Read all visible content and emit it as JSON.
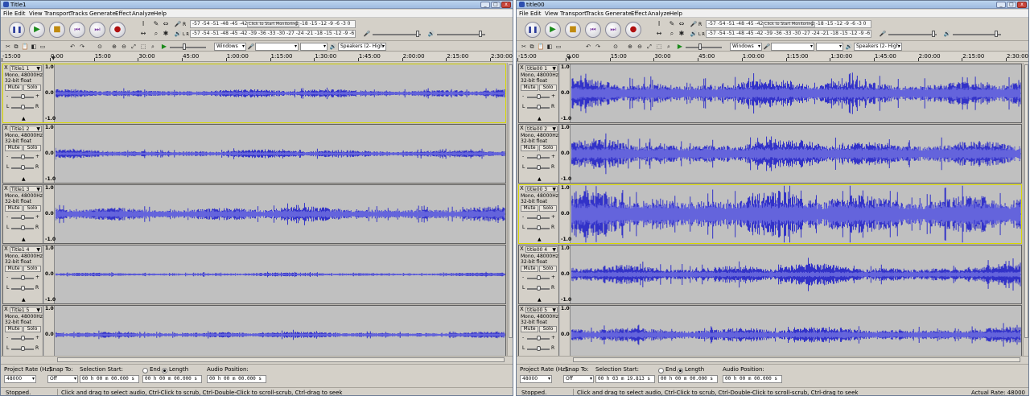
{
  "colors": {
    "wave": "#3232c8",
    "wave_rms": "#6464dc",
    "track_bg": "#c0c0c0",
    "selected_border": "#d8d800"
  },
  "menu": [
    "File",
    "Edit",
    "View",
    "Transport",
    "Tracks",
    "Generate",
    "Effect",
    "Analyze",
    "Help"
  ],
  "transport_icons": [
    "pause-icon",
    "play-icon",
    "stop-icon",
    "skip-start-icon",
    "skip-end-icon",
    "record-icon"
  ],
  "meters": {
    "rec_label": "R",
    "play_label": "L R",
    "rec_scale": "-57 -54 -51 -48 -45 -42 -",
    "monitor_label": "Click to Start Monitoring",
    "rec_scale_tail": "-1 -18 -15 -12 -9 -6 -3 0",
    "play_scale": "-57 -54 -51 -48 -45 -42 -39 -36 -33 -30 -27 -24 -21 -18 -15 -12 -9 -6 -3 0"
  },
  "devices": {
    "host": "Windows",
    "output": "Speakers (2- High"
  },
  "windows": [
    {
      "title": "Title1",
      "ruler": [
        "-15:00",
        "0:00",
        "15:00",
        "30:00",
        "45:00",
        "1:00:00",
        "1:15:00",
        "1:30:00",
        "1:45:00",
        "2:00:00",
        "2:15:00",
        "2:30:00"
      ],
      "tracks": [
        {
          "name": "Title1 1",
          "sel": true,
          "amp": 0.16,
          "rms": 0.06,
          "seed": 11
        },
        {
          "name": "Title1 2",
          "sel": false,
          "amp": 0.16,
          "rms": 0.06,
          "seed": 23
        },
        {
          "name": "Title1 3",
          "sel": false,
          "amp": 0.28,
          "rms": 0.14,
          "seed": 37
        },
        {
          "name": "Title1 4",
          "sel": false,
          "amp": 0.07,
          "rms": 0.03,
          "seed": 41
        },
        {
          "name": "Title1 5",
          "sel": false,
          "amp": 0.12,
          "rms": 0.05,
          "seed": 53
        }
      ],
      "project_rate": "48000",
      "snap": "Off",
      "selection_start": "00 h 00 m 00.000 s",
      "selection_length": "00 h 00 m 00.000 s",
      "audio_position": "00 h 00 m 00.000 s",
      "status_left": "Stopped.",
      "status_right": "",
      "status_hint": "Click and drag to select audio, Ctrl-Click to scrub, Ctrl-Double-Click to scroll-scrub, Ctrl-drag to seek"
    },
    {
      "title": "title00",
      "ruler": [
        "-15:00",
        "0:00",
        "15:00",
        "30:00",
        "45:00",
        "1:00:00",
        "1:15:00",
        "1:30:00",
        "1:45:00",
        "2:00:00",
        "2:15:00",
        "2:30:00"
      ],
      "tracks": [
        {
          "name": "title00 1",
          "sel": false,
          "amp": 0.55,
          "rms": 0.22,
          "seed": 61
        },
        {
          "name": "title00 2",
          "sel": false,
          "amp": 0.55,
          "rms": 0.22,
          "seed": 73
        },
        {
          "name": "title00 3",
          "sel": true,
          "amp": 0.85,
          "rms": 0.4,
          "seed": 89
        },
        {
          "name": "title00 4",
          "sel": false,
          "amp": 0.4,
          "rms": 0.1,
          "seed": 97
        },
        {
          "name": "title00 5",
          "sel": false,
          "amp": 0.3,
          "rms": 0.12,
          "seed": 103
        }
      ],
      "project_rate": "48000",
      "snap": "Off",
      "selection_start": "00 h 03 m 19.813 s",
      "selection_length": "00 h 00 m 00.000 s",
      "audio_position": "00 h 00 m 00.000 s",
      "status_left": "Stopped.",
      "status_right": "Actual Rate: 48000",
      "status_hint": "Click and drag to select audio, Ctrl-Click to scrub, Ctrl-Double-Click to scroll-scrub, Ctrl-drag to seek"
    }
  ],
  "track_info": {
    "format_line1": "Mono, 48000Hz",
    "format_line2": "32-bit float",
    "mute": "Mute",
    "solo": "Solo",
    "gain_minus": "-",
    "gain_plus": "+",
    "pan_l": "L",
    "pan_r": "R",
    "scale_top": "1.0",
    "scale_mid": "0.0",
    "scale_bottom": "-1.0",
    "close": "X",
    "dropdown": "▼",
    "collapse": "▲"
  },
  "selection_toolbar": {
    "project_rate_label": "Project Rate (Hz):",
    "snap_label": "Snap To:",
    "selection_start_label": "Selection Start:",
    "end_label": "End",
    "length_label": "Length",
    "audio_position_label": "Audio Position:"
  }
}
